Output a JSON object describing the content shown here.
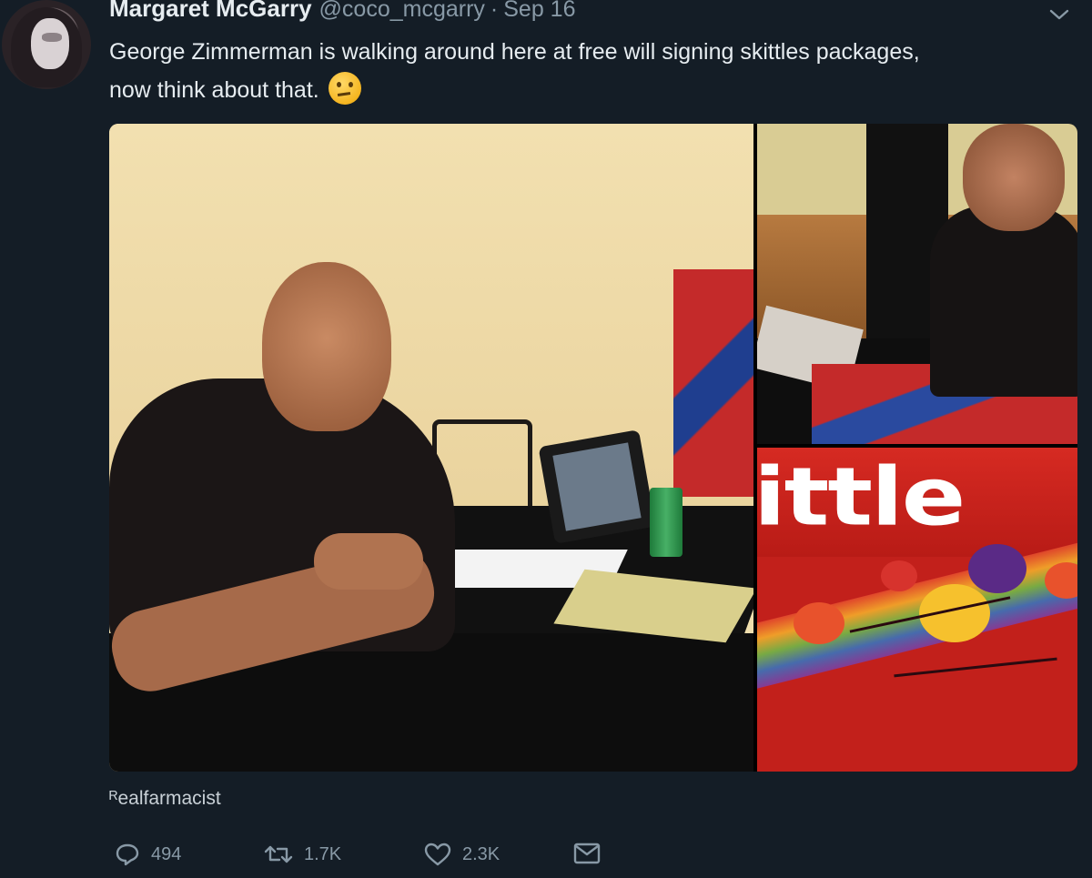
{
  "tweet": {
    "author_name": "Margaret McGarry",
    "handle": "@coco_mcgarry",
    "separator": "·",
    "date": "Sep 16",
    "text_line1": "George Zimmerman is walking around here at free will signing skittles packages,",
    "text_line2": "now think about that.",
    "emoji": "thinking-face-emoji"
  },
  "media": {
    "packaging_text": "ittle",
    "credit": "ᴿealfarmacist"
  },
  "actions": {
    "reply_count": "494",
    "retweet_count": "1.7K",
    "like_count": "2.3K"
  },
  "colors": {
    "background": "#141d26",
    "text": "#e6ecf0",
    "secondary": "#8899a6"
  }
}
